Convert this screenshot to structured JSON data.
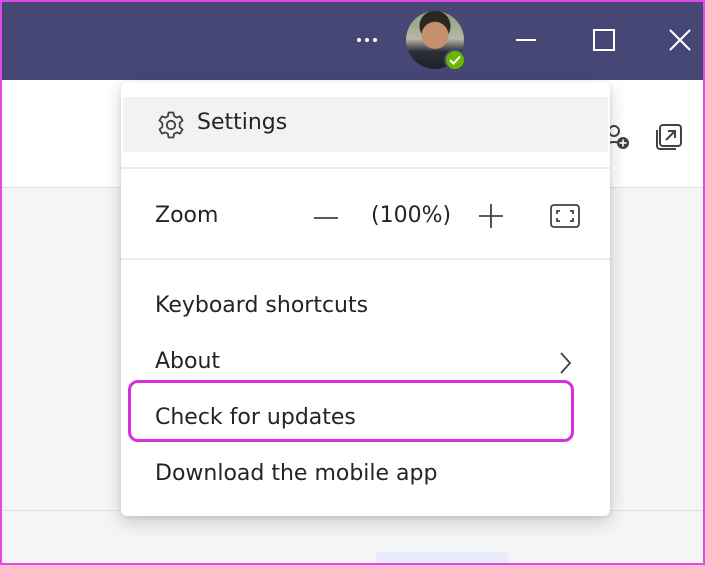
{
  "titlebar": {
    "more_icon": "more-horizontal-icon",
    "avatar_status": "available",
    "window_controls": [
      "minimize-icon",
      "maximize-icon",
      "close-icon"
    ]
  },
  "background_icons": [
    "add-people-icon",
    "popout-icon"
  ],
  "menu": {
    "settings": {
      "label": "Settings",
      "icon": "gear-icon"
    },
    "zoom": {
      "label": "Zoom",
      "level": "(100%)",
      "icons": [
        "zoom-out-icon",
        "zoom-in-icon",
        "fullscreen-icon"
      ]
    },
    "items": [
      {
        "label": "Keyboard shortcuts"
      },
      {
        "label": "About",
        "icon": "chevron-right-icon"
      },
      {
        "label": "Check for updates",
        "highlighted": true
      },
      {
        "label": "Download the mobile app"
      }
    ]
  },
  "colors": {
    "titlebar": "#464775",
    "menu_hover": "#f3f2f1",
    "highlight": "#d630e0",
    "presence": "#6bb700"
  }
}
